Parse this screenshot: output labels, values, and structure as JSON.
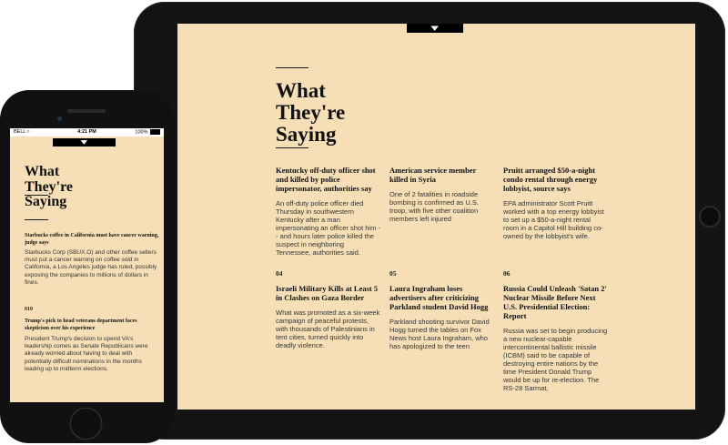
{
  "tablet": {
    "title_lines": [
      "What",
      "They're",
      "Saying"
    ],
    "items": [
      {
        "number": "",
        "headline": "Kentucky off-duty officer shot and killed by police impersonator, authorities say",
        "body": "An off-duty police officer died Thursday in southwestern Kentucky after a man impersonating an officer shot him -- and hours later police killed the suspect in neighboring Tennessee, authorities said."
      },
      {
        "number": "",
        "headline": "American service member killed in Syria",
        "body": "One of 2 fatalities in roadside bombing is confirmed as U.S. troop, with five other coalition members left injured"
      },
      {
        "number": "",
        "headline": "Pruitt arranged $50-a-night condo rental through energy lobbyist, source says",
        "body": "EPA administrator Scott Pruitt worked with a top energy lobbyist to set up a $50-a-night rental room in a Capitol Hill building co-owned by the lobbyist's wife."
      },
      {
        "number": "04",
        "headline": "Israeli Military Kills at Least 5 in Clashes on Gaza Border",
        "body": "What was promoted as a six-week campaign of peaceful protests, with thousands of Palestinians in tent cities, turned quickly into deadly violence."
      },
      {
        "number": "05",
        "headline": "Laura Ingraham loses advertisers after criticizing Parkland student David Hogg",
        "body": "Parkland shooting survivor David Hogg turned the tables on Fox News host Laura Ingraham, who has apologized to the teen"
      },
      {
        "number": "06",
        "headline": "Russia Could Unleash 'Satan 2' Nuclear Missile Before Next U.S. Presidential Election: Report",
        "body": "Russia was set to begin producing a new nuclear-capable intercontinental ballistic missile (ICBM) said to be capable of destroying entire nations by the time President Donald Trump would be up for re-election. The RS-28 Sarmat,"
      }
    ]
  },
  "phone": {
    "status": {
      "carrier": "BELL",
      "time": "4:21 PM",
      "battery": "100%"
    },
    "title_lines": [
      "What",
      "They're",
      "Saying"
    ],
    "items": [
      {
        "number": "",
        "headline": "Starbucks coffee in California must have cancer warning, judge says",
        "body": "Starbucks Corp (SBUX.O) and other coffee sellers must put a cancer warning on coffee sold in California, a Los Angeles judge has ruled, possibly exposing the companies to millions of dollars in fines."
      },
      {
        "number": "010",
        "headline": "Trump's pick to head veterans department faces skepticism over his experience",
        "body": "President Trump's decision to upend VA's leadership comes as Senate Republicans were already worried about having to deal with potentially difficult nominations in the months leading up to midterm elections."
      }
    ]
  },
  "icons": {
    "pull_tab": "chevron-down-icon",
    "wifi": "wifi-icon",
    "battery": "battery-icon"
  },
  "colors": {
    "screen_bg": "#f6dfb6",
    "device_frame": "#141414",
    "text": "#111111"
  }
}
